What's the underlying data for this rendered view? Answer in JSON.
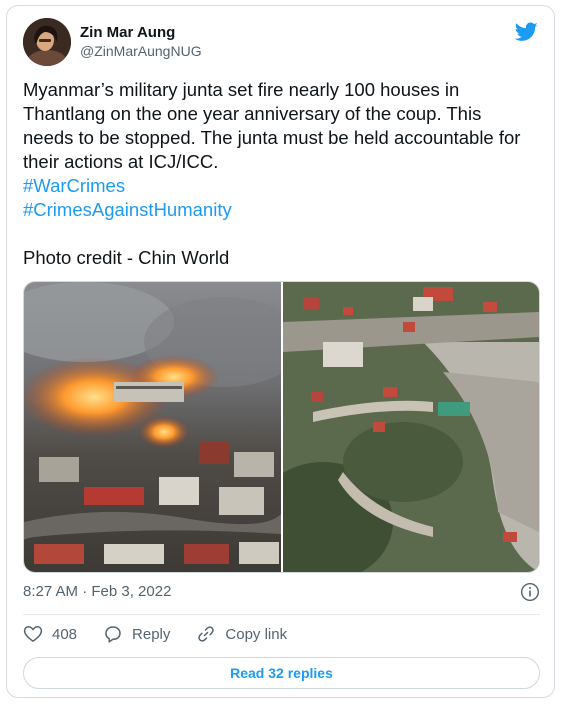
{
  "author": {
    "name": "Zin Mar Aung",
    "handle": "@ZinMarAungNUG"
  },
  "tweet": {
    "text": "Myanmar’s military junta set fire nearly 100 houses in Thantlang on the one year anniversary of the coup. This needs to be stopped. The junta must be held accountable for their actions at ICJ/ICC.",
    "hashtags": [
      "#WarCrimes",
      "#CrimesAgainstHumanity"
    ],
    "credit": "Photo credit - Chin World"
  },
  "timestamp": "8:27 AM · Feb 3, 2022",
  "actions": {
    "likes": "408",
    "reply_label": "Reply",
    "copy_label": "Copy link"
  },
  "read_replies_label": "Read 32 replies",
  "colors": {
    "accent": "#1d9bf0",
    "secondary_text": "#536471",
    "primary_text": "#0f1419"
  },
  "icons": {
    "platform": "twitter-bird-icon",
    "info": "info-icon",
    "like": "heart-icon",
    "reply": "reply-bubble-icon",
    "copy": "link-icon"
  }
}
